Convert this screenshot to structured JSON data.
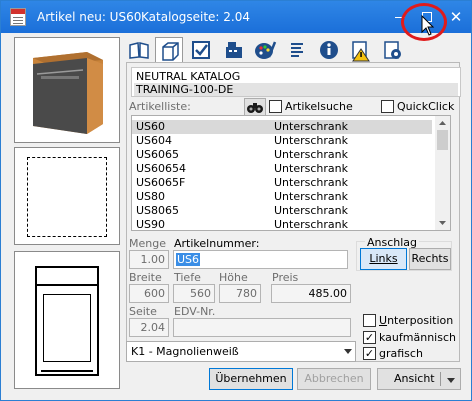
{
  "window": {
    "title": "Artikel neu: US60",
    "catalog_page": "Katalogseite: 2.04",
    "close_glyph": "✕"
  },
  "toolbar": {
    "icons": [
      "book-icon",
      "cube-icon",
      "checkbox-icon",
      "cash-register-icon",
      "palette-icon",
      "text-lines-icon",
      "info-icon",
      "warning-document-icon",
      "settings-document-icon"
    ]
  },
  "catalog": {
    "line1": "NEUTRAL KATALOG",
    "line2": "TRAINING-100-DE"
  },
  "list": {
    "label": "Artikelliste:",
    "search_label": "Artikelsuche",
    "quickclick_label": "QuickClick",
    "rows": [
      {
        "code": "US60",
        "type": "Unterschrank"
      },
      {
        "code": "US604",
        "type": "Unterschrank"
      },
      {
        "code": "US6065",
        "type": "Unterschrank"
      },
      {
        "code": "US60654",
        "type": "Unterschrank"
      },
      {
        "code": "US6065F",
        "type": "Unterschrank"
      },
      {
        "code": "US80",
        "type": "Unterschrank"
      },
      {
        "code": "US8065",
        "type": "Unterschrank"
      },
      {
        "code": "US90",
        "type": "Unterschrank"
      }
    ]
  },
  "fields": {
    "menge_label": "Menge",
    "menge_value": "1.00",
    "artnr_label": "Artikelnummer:",
    "artnr_value": "US6",
    "anschlag_label": "Anschlag",
    "links_label": "Links",
    "rechts_label": "Rechts",
    "breite_label": "Breite",
    "breite_value": "600",
    "tiefe_label": "Tiefe",
    "tiefe_value": "560",
    "hoehe_label": "Höhe",
    "hoehe_value": "780",
    "preis_label": "Preis",
    "preis_value": "485.00",
    "seite_label": "Seite",
    "seite_value": "2.04",
    "edv_label": "EDV-Nr.",
    "edv_value": "",
    "unterposition_label": "Unterposition",
    "kaufm_label": "kaufmännisch",
    "grafisch_label": "grafisch"
  },
  "combo": {
    "value": "K1 - Magnolienweiß"
  },
  "buttons": {
    "uebernehmen": "Übernehmen",
    "abbrechen": "Abbrechen",
    "ansicht": "Ansicht"
  },
  "colors": {
    "titlebar": "#1b6fd9",
    "highlight": "#e01b1b",
    "selection": "#3a8ee6"
  }
}
